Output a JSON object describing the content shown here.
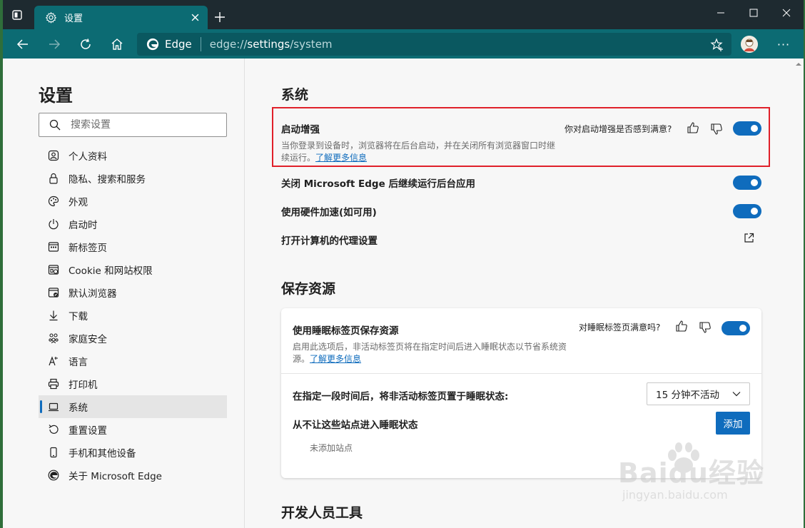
{
  "browser": {
    "tab_title": "设置",
    "edge_label": "Edge",
    "url_prefix": "edge://",
    "url_path": "settings",
    "url_suffix": "/system",
    "more_label": "···"
  },
  "sidebar": {
    "title": "设置",
    "search_placeholder": "搜索设置",
    "items": [
      {
        "label": "个人资料",
        "icon": "profile-icon"
      },
      {
        "label": "隐私、搜索和服务",
        "icon": "lock-icon"
      },
      {
        "label": "外观",
        "icon": "palette-icon"
      },
      {
        "label": "启动时",
        "icon": "power-icon"
      },
      {
        "label": "新标签页",
        "icon": "new-tab-icon"
      },
      {
        "label": "Cookie 和网站权限",
        "icon": "cookie-site-icon"
      },
      {
        "label": "默认浏览器",
        "icon": "default-browser-icon"
      },
      {
        "label": "下载",
        "icon": "download-icon"
      },
      {
        "label": "家庭安全",
        "icon": "family-icon"
      },
      {
        "label": "语言",
        "icon": "language-icon"
      },
      {
        "label": "打印机",
        "icon": "printer-icon"
      },
      {
        "label": "系统",
        "icon": "laptop-icon",
        "active": true
      },
      {
        "label": "重置设置",
        "icon": "reset-icon"
      },
      {
        "label": "手机和其他设备",
        "icon": "phone-icon"
      },
      {
        "label": "关于 Microsoft Edge",
        "icon": "edge-icon"
      }
    ]
  },
  "main": {
    "system_heading": "系统",
    "startup_boost": {
      "title": "启动增强",
      "desc": "当你登录到设备时，浏览器将在后台启动，并在关闭所有浏览器窗口时继续运行。",
      "learn_more": "了解更多信息",
      "feedback_question": "你对启动增强是否感到满意?",
      "enabled": true
    },
    "background_apps": {
      "title": "关闭 Microsoft Edge 后继续运行后台应用",
      "enabled": true
    },
    "hardware_accel": {
      "title": "使用硬件加速(如可用)",
      "enabled": true
    },
    "proxy": {
      "title": "打开计算机的代理设置"
    },
    "save_resources_heading": "保存资源",
    "sleeping_tabs": {
      "title": "使用睡眠标签页保存资源",
      "desc": "启用此选项后，非活动标签页将在指定时间后进入睡眠状态以节省系统资源。",
      "learn_more": "了解更多信息",
      "feedback_question": "对睡眠标签页满意吗?",
      "enabled": true
    },
    "sleep_after": {
      "label": "在指定一段时间后，将非活动标签页置于睡眠状态:",
      "value": "15 分钟不活动"
    },
    "never_sleep": {
      "label": "从不让这些站点进入睡眠状态",
      "add_button": "添加",
      "empty_text": "未添加站点"
    },
    "dev_tools_heading": "开发人员工具"
  },
  "watermark": {
    "text": "Baidu经验",
    "sub": "jingyan.baidu.com"
  },
  "colors": {
    "accent": "#0f6cbd",
    "toolbar": "#0c6b73",
    "highlight": "#e0202a"
  }
}
